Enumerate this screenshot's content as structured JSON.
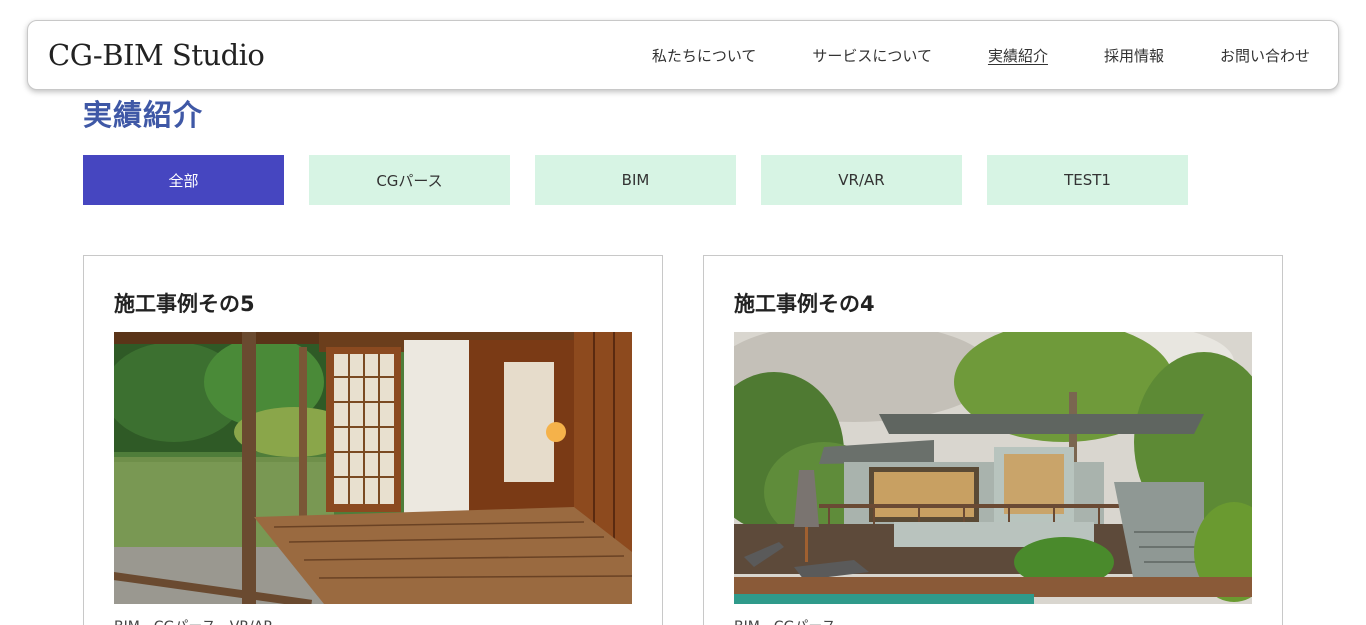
{
  "header": {
    "logo": "CG-BIM Studio",
    "nav": [
      {
        "label": "私たちについて",
        "active": false
      },
      {
        "label": "サービスについて",
        "active": false
      },
      {
        "label": "実績紹介",
        "active": true
      },
      {
        "label": "採用情報",
        "active": false
      },
      {
        "label": "お問い合わせ",
        "active": false
      }
    ]
  },
  "page": {
    "title": "実績紹介"
  },
  "filters": [
    {
      "label": "全部",
      "active": true
    },
    {
      "label": "CGパース",
      "active": false
    },
    {
      "label": "BIM",
      "active": false
    },
    {
      "label": "VR/AR",
      "active": false
    },
    {
      "label": "TEST1",
      "active": false
    }
  ],
  "cards": [
    {
      "title": "施工事例その5",
      "tags": "BIM、CGパース、VR/AR",
      "image": "japanese-tea-house-photo"
    },
    {
      "title": "施工事例その4",
      "tags": "BIM、CGパース",
      "image": "modern-villa-photo"
    }
  ],
  "colors": {
    "accent_title": "#3f58a6",
    "filter_active_bg": "#4646c0",
    "filter_bg": "#d7f4e4"
  }
}
